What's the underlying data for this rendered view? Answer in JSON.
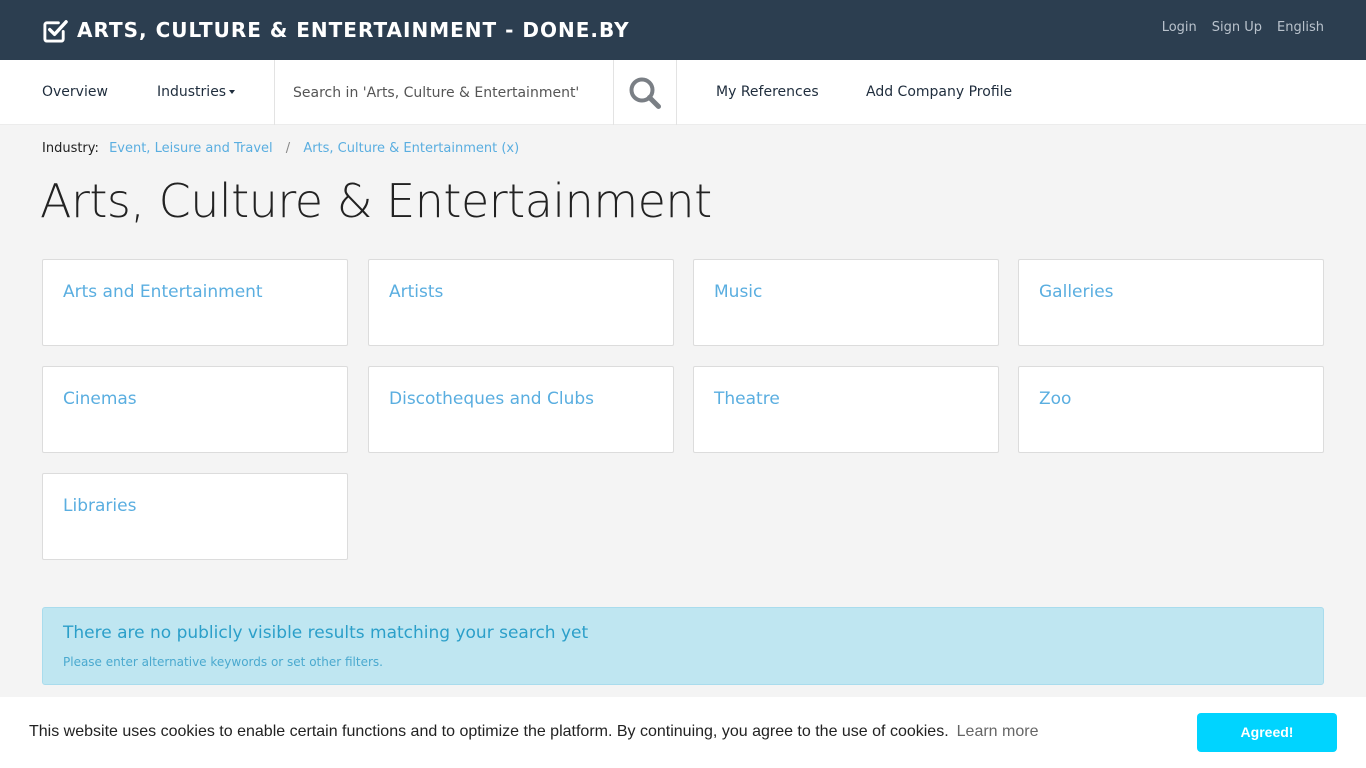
{
  "header": {
    "brand_title": "ARTS, CULTURE & ENTERTAINMENT - DONE.BY",
    "logo_icon": "check-square-icon",
    "links": {
      "login": "Login",
      "signup": "Sign Up",
      "language": "English"
    }
  },
  "nav": {
    "overview": "Overview",
    "industries": "Industries",
    "search_placeholder": "Search in 'Arts, Culture & Entertainment'",
    "search_icon": "search-icon",
    "my_references": "My References",
    "add_company_profile": "Add Company Profile"
  },
  "breadcrumb": {
    "label": "Industry:",
    "items": [
      "Event, Leisure and Travel",
      "Arts, Culture & Entertainment (x)"
    ],
    "separator": "/"
  },
  "page": {
    "title": "Arts, Culture & Entertainment"
  },
  "categories": [
    "Arts and Entertainment",
    "Artists",
    "Music",
    "Galleries",
    "Cinemas",
    "Discotheques and Clubs",
    "Theatre",
    "Zoo",
    "Libraries"
  ],
  "alert": {
    "title": "There are no publicly visible results matching your search yet",
    "text": "Please enter alternative keywords or set other filters."
  },
  "cookie": {
    "text": "This website uses cookies to enable certain functions and to optimize the platform. By continuing, you agree to the use of cookies.",
    "learn_more": "Learn more",
    "button": "Agreed!"
  },
  "colors": {
    "header_bg": "#2c3e50",
    "link": "#5aaee0",
    "alert_bg": "#bfe6f1",
    "cookie_button": "#00d4ff"
  }
}
